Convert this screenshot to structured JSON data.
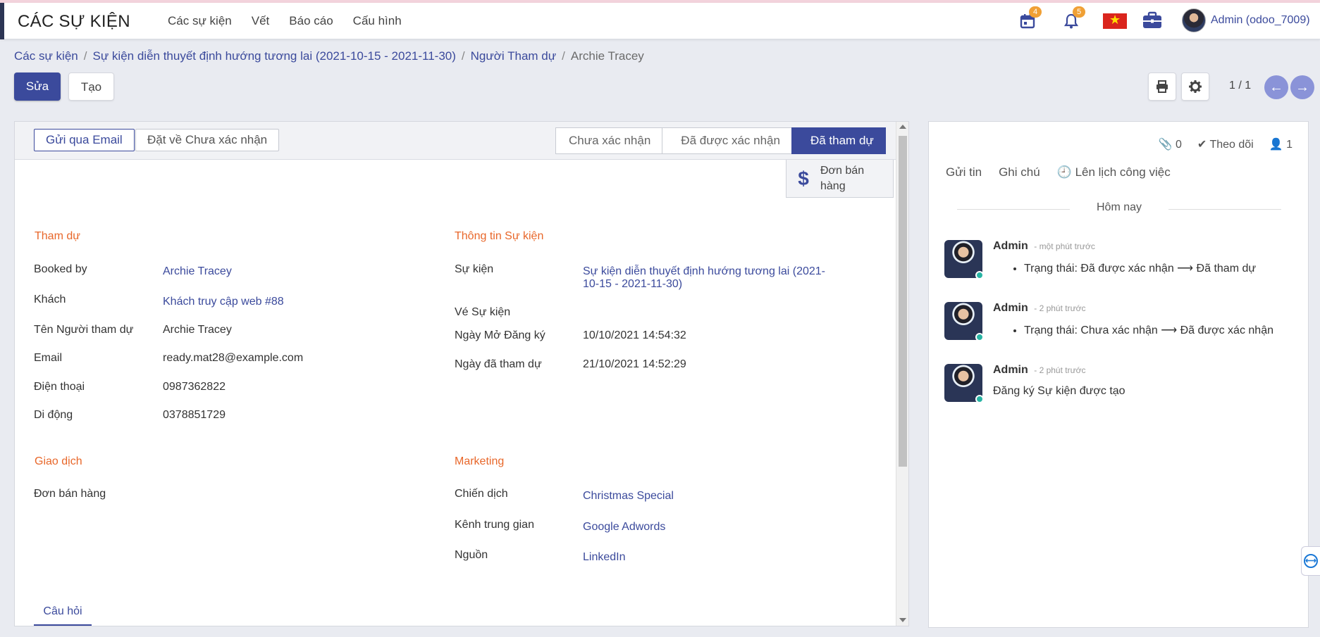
{
  "app": {
    "title": "CÁC SỰ KIỆN"
  },
  "menu": [
    "Các sự kiện",
    "Vết",
    "Báo cáo",
    "Cấu hình"
  ],
  "systray": {
    "calendar_count": "4",
    "notification_count": "5",
    "user": "Admin (odoo_7009)"
  },
  "breadcrumb": [
    "Các sự kiện",
    "Sự kiện diễn thuyết định hướng tương lai (2021-10-15 - 2021-11-30)",
    "Người Tham dự",
    "Archie Tracey"
  ],
  "buttons": {
    "edit": "Sửa",
    "create": "Tạo"
  },
  "pager": "1 / 1",
  "statusbar": {
    "send_email": "Gửi qua Email",
    "reset": "Đặt về Chưa xác nhận",
    "stages": [
      "Chưa xác nhận",
      "Đã được xác nhận",
      "Đã tham dự"
    ],
    "active_stage": "Đã tham dự"
  },
  "smart_button": {
    "line1": "Đơn bán",
    "line2": "hàng"
  },
  "attendance": {
    "title": "Tham dự",
    "booked_by_label": "Booked by",
    "booked_by": "Archie Tracey",
    "guest_label": "Khách",
    "guest": "Khách truy cập web #88",
    "name_label": "Tên Người tham dự",
    "name": "Archie Tracey",
    "email_label": "Email",
    "email": "ready.mat28@example.com",
    "phone_label": "Điện thoại",
    "phone": "0987362822",
    "mobile_label": "Di động",
    "mobile": "0378851729"
  },
  "event_info": {
    "title": "Thông tin Sự kiện",
    "event_label": "Sự kiện",
    "event_line1": "Sự kiện diễn thuyết định hướng tương lai (2021-",
    "event_line2": "10-15 - 2021-11-30)",
    "ticket_label": "Vé Sự kiện",
    "reg_open_label": "Ngày Mở Đăng ký",
    "reg_open": "10/10/2021 14:54:32",
    "attended_label": "Ngày đã tham dự",
    "attended": "21/10/2021 14:52:29"
  },
  "transaction": {
    "title": "Giao dịch",
    "sale_order_label": "Đơn bán hàng"
  },
  "marketing": {
    "title": "Marketing",
    "campaign_label": "Chiến dịch",
    "campaign": "Christmas Special",
    "medium_label": "Kênh trung gian",
    "medium": "Google Adwords",
    "source_label": "Nguồn",
    "source": "LinkedIn"
  },
  "tabs": {
    "questions": "Câu hỏi"
  },
  "chatter": {
    "attachments": "0",
    "follow": "Theo dõi",
    "followers": "1",
    "send_message": "Gửi tin",
    "log_note": "Ghi chú",
    "schedule": "Lên lịch công việc",
    "today": "Hôm nay",
    "messages": [
      {
        "author": "Admin",
        "time": "- một phút trước",
        "body": "Trạng thái: Đã được xác nhận ⟶ Đã tham dự"
      },
      {
        "author": "Admin",
        "time": "- 2 phút trước",
        "body": "Trạng thái: Chưa xác nhận ⟶ Đã được xác nhận"
      },
      {
        "author": "Admin",
        "time": "- 2 phút trước",
        "body": "Đăng ký Sự kiện được tạo"
      }
    ]
  },
  "colors": {
    "primary": "#3b4a9c",
    "section": "#e8672a",
    "badge": "#f0a035"
  }
}
